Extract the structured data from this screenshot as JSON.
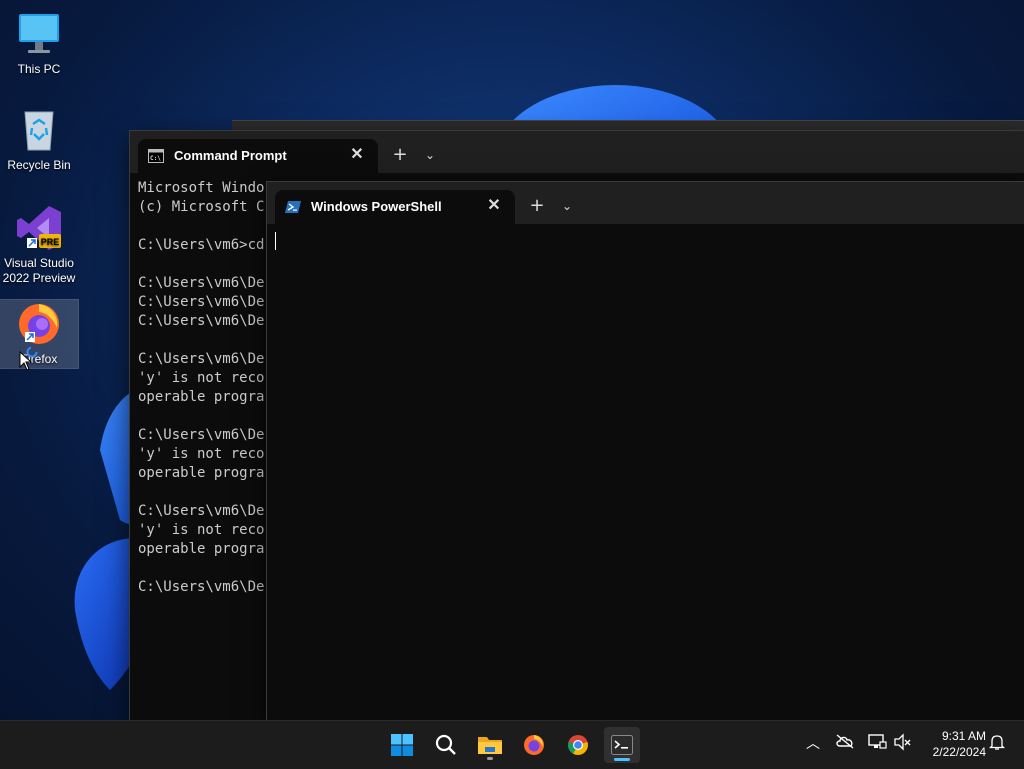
{
  "desktop": {
    "icons": [
      {
        "label": "This PC"
      },
      {
        "label": "Recycle Bin"
      },
      {
        "label": "Visual Studio 2022 Preview",
        "badge": "PRE"
      },
      {
        "label": "Firefox"
      }
    ]
  },
  "cmd_window": {
    "tab_title": "Command Prompt",
    "lines": [
      "Microsoft Windo",
      "(c) Microsoft C",
      "",
      "C:\\Users\\vm6>cd",
      "",
      "C:\\Users\\vm6\\De",
      "C:\\Users\\vm6\\De",
      "C:\\Users\\vm6\\De",
      "",
      "C:\\Users\\vm6\\De",
      "'y' is not reco",
      "operable progra",
      "",
      "C:\\Users\\vm6\\De",
      "'y' is not reco",
      "operable progra",
      "",
      "C:\\Users\\vm6\\De",
      "'y' is not reco",
      "operable progra",
      "",
      "C:\\Users\\vm6\\De"
    ]
  },
  "ps_window": {
    "tab_title": "Windows PowerShell",
    "content": ""
  },
  "taskbar": {
    "apps": [
      {
        "name": "start",
        "icon": "windows-logo-icon"
      },
      {
        "name": "search",
        "icon": "search-icon"
      },
      {
        "name": "file-explorer",
        "icon": "folder-icon"
      },
      {
        "name": "firefox",
        "icon": "firefox-icon"
      },
      {
        "name": "chrome",
        "icon": "chrome-icon"
      },
      {
        "name": "terminal",
        "icon": "terminal-icon"
      }
    ],
    "clock": {
      "time": "9:31 AM",
      "date": "2/22/2024"
    }
  },
  "colors": {
    "accent": "#4cc2ff",
    "terminal_bg": "#0c0c0c",
    "terminal_fg": "#cccccc",
    "tabstrip": "#202020",
    "taskbar": "#1c1c1c"
  }
}
